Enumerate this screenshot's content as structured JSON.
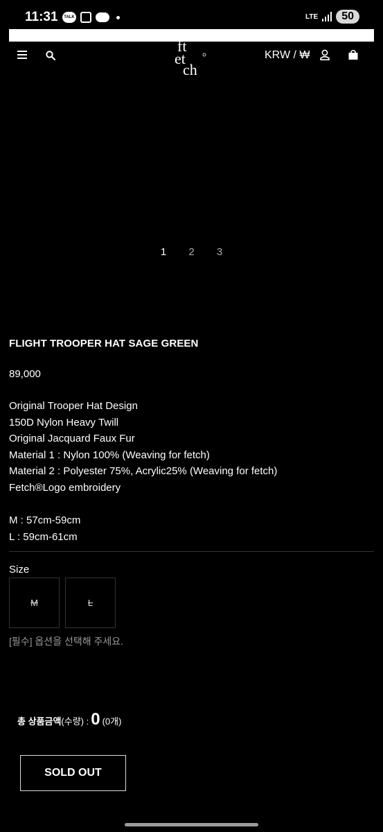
{
  "status_bar": {
    "time": "11:31",
    "notif_talk": "TALK",
    "network": "LTE",
    "battery": "50"
  },
  "header": {
    "menu_icon": "hamburger-menu-icon",
    "search_icon": "search-icon",
    "logo_text": "fetch",
    "currency": "KRW / ₩",
    "user_icon": "user-icon",
    "cart_icon": "shopping-bag-icon"
  },
  "gallery": {
    "pages": [
      "1",
      "2",
      "3"
    ],
    "active_page": "1"
  },
  "product": {
    "title": "FLIGHT TROOPER HAT SAGE GREEN",
    "price": "89,000",
    "description": [
      "Original Trooper Hat Design",
      "150D Nylon Heavy Twill",
      "Original Jacquard Faux Fur",
      "Material 1 : Nylon 100% (Weaving for fetch)",
      "Material 2 : Polyester 75%, Acrylic25% (Weaving for fetch)",
      "Fetch®Logo embroidery"
    ],
    "sizes_info": [
      "M : 57cm-59cm",
      "L : 59cm-61cm"
    ]
  },
  "options": {
    "size_label": "Size",
    "sizes": [
      "M",
      "L"
    ],
    "required_note": "[필수] 옵션을 선택해 주세요."
  },
  "total": {
    "label_bold": "총 상품금액",
    "label_qty": "(수량) :",
    "amount": "0",
    "count": "(0개)"
  },
  "actions": {
    "sold_out_label": "SOLD OUT"
  },
  "colors": {
    "background": "#000000",
    "text": "#ffffff",
    "muted": "#999999"
  }
}
